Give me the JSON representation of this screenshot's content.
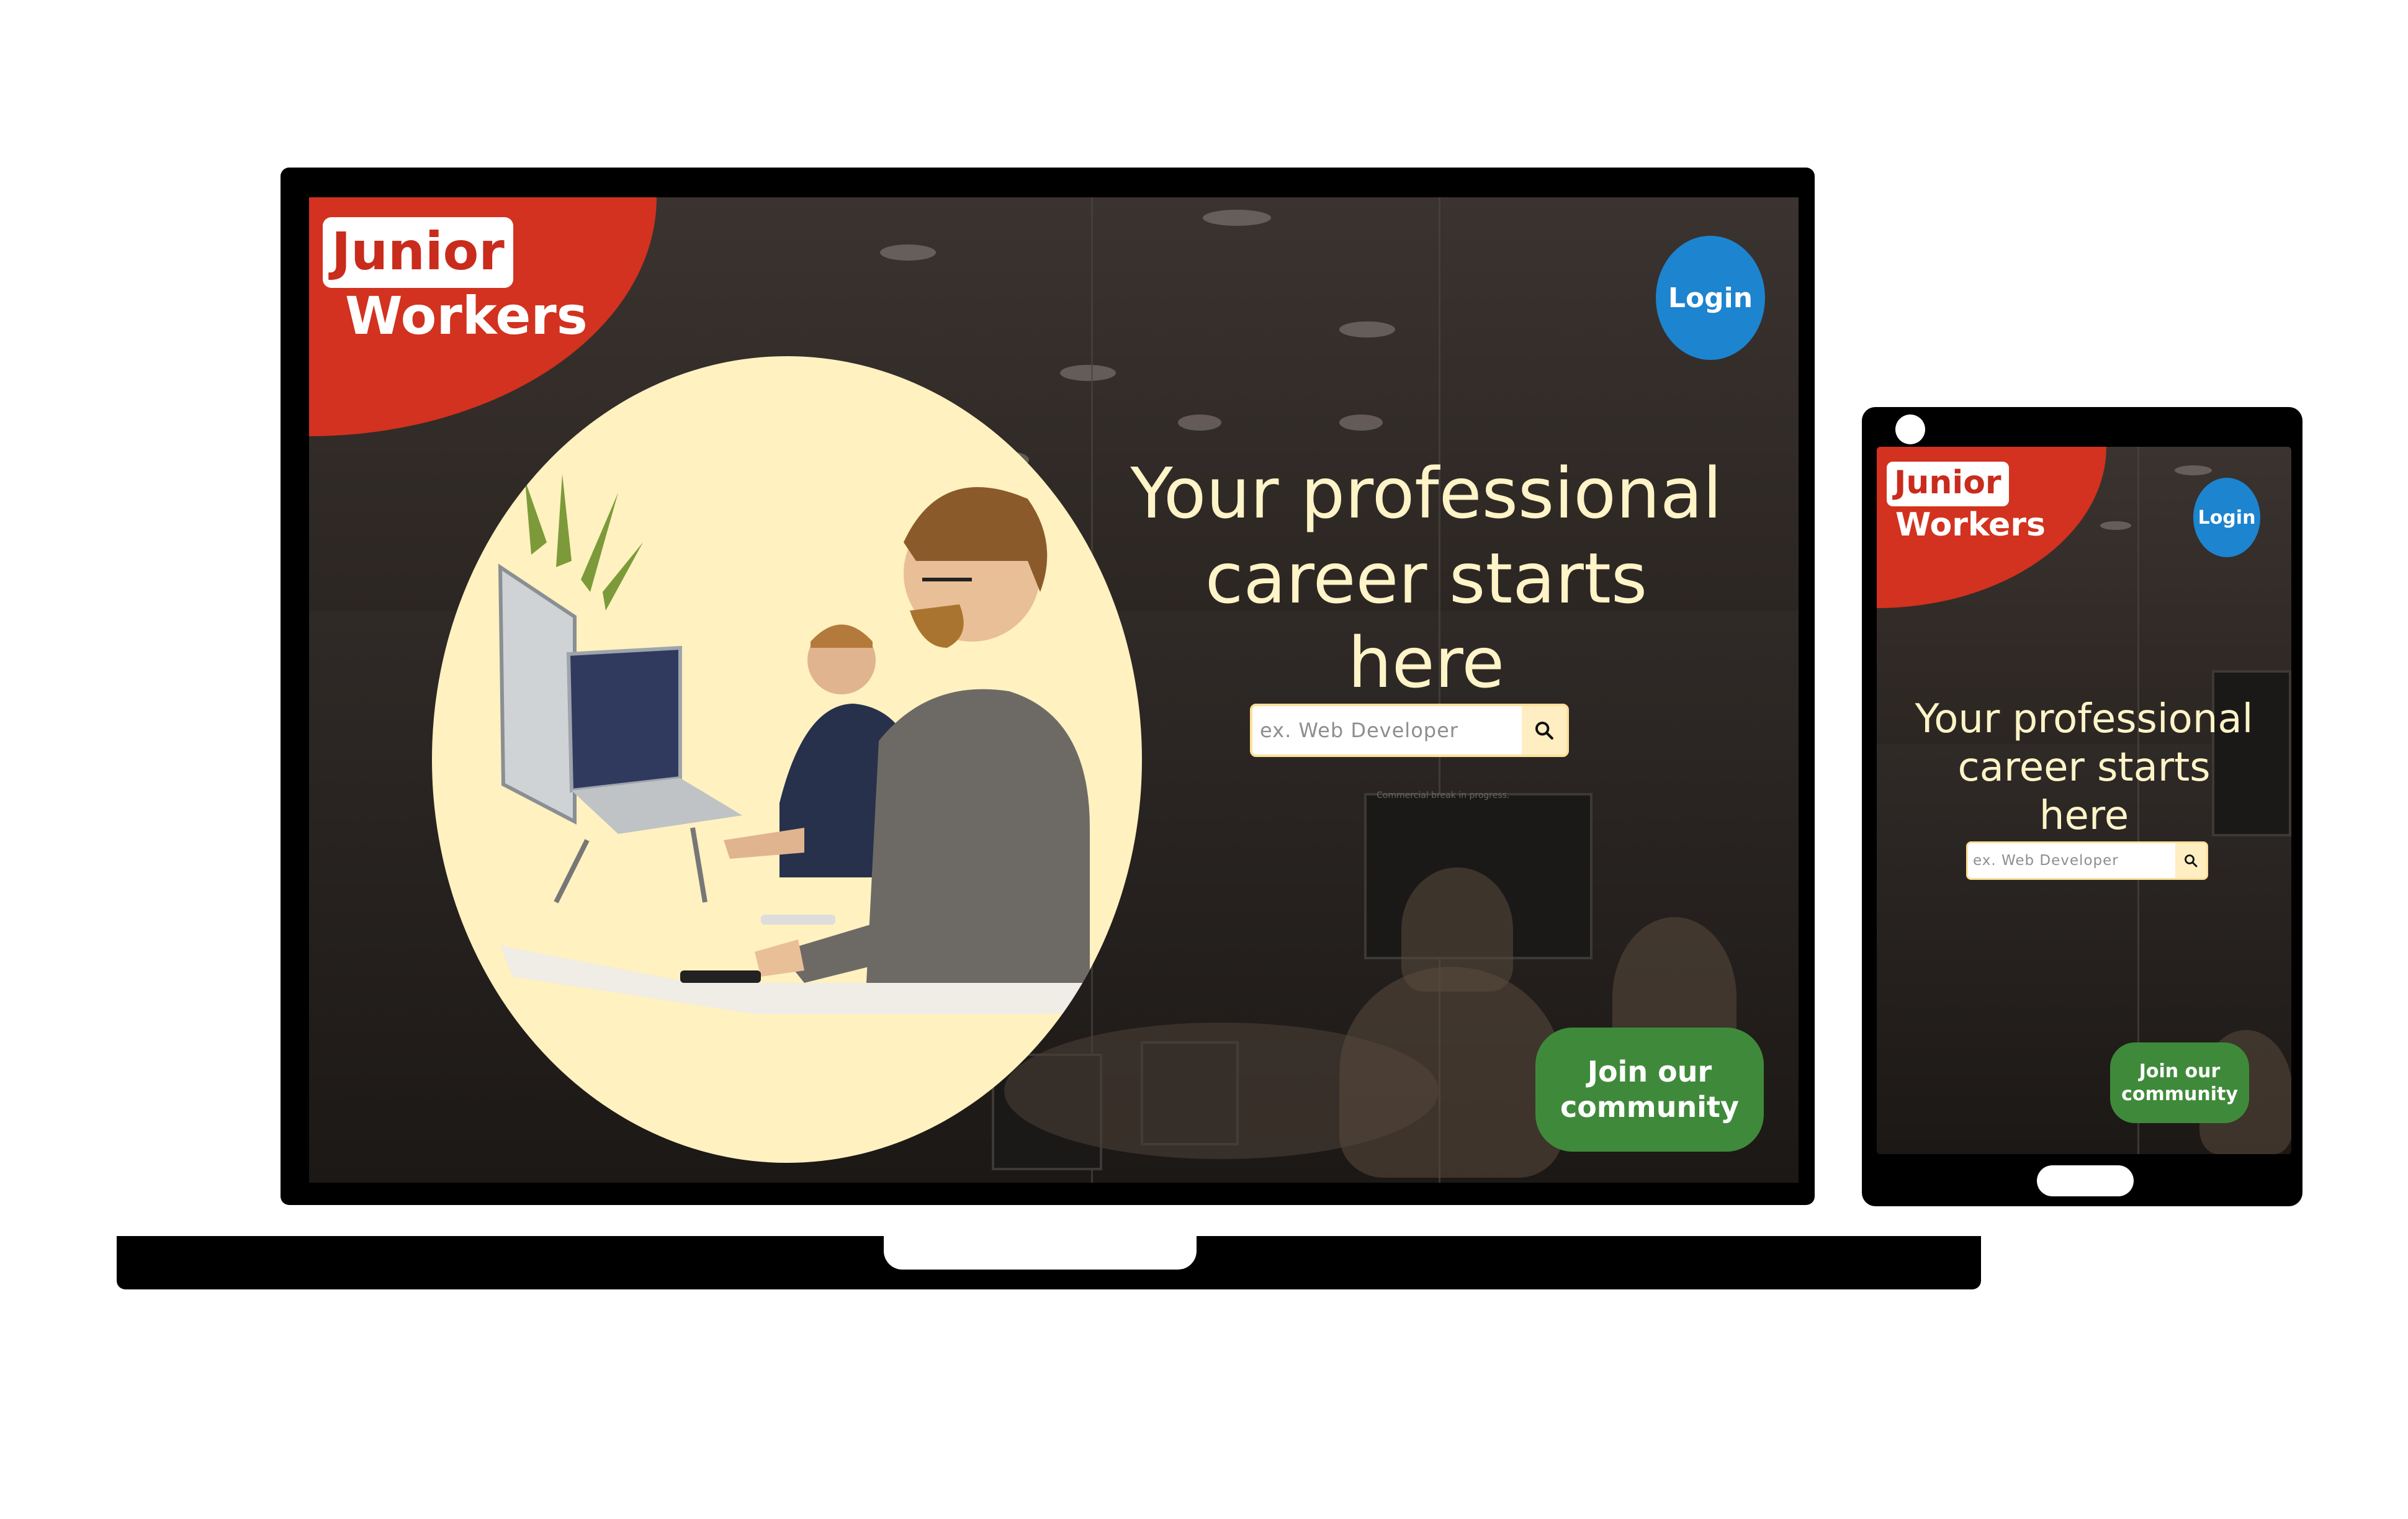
{
  "brand": {
    "logo_top": "Junior",
    "logo_bottom": "Workers",
    "primary_color": "#d2321f",
    "login_color": "#1d84cf",
    "join_color": "#3f8a3a",
    "headline_color": "#fff4c7",
    "accent_circle": "#fff1c0"
  },
  "desktop": {
    "login_label": "Login",
    "headline_line1": "Your professional",
    "headline_line2": "career starts",
    "headline_line3": "here",
    "search_placeholder": "ex. Web Developer",
    "search_icon": "search-icon",
    "join_line1": "Join our",
    "join_line2": "community",
    "caption": "Commercial break in progress."
  },
  "tablet": {
    "login_label": "Login",
    "headline_line1": "Your professional",
    "headline_line2": "career starts",
    "headline_line3": "here",
    "search_placeholder": "ex. Web Developer",
    "search_icon": "search-icon",
    "join_line1": "Join our",
    "join_line2": "community"
  }
}
